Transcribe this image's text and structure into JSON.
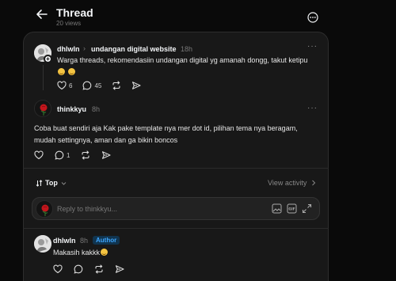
{
  "header": {
    "title": "Thread",
    "views": "20 views"
  },
  "original_post": {
    "username": "dhlwln",
    "topic": "undangan digital website",
    "time": "18h",
    "text": "Warga threads, rekomendasiin undangan digital yg amanah dongg, takut ketipu",
    "likes": "6",
    "replies": "45"
  },
  "reply_post": {
    "username": "thinkkyu",
    "time": "8h",
    "text_line1": "Coba buat sendiri aja Kak pake template nya mer dot id, pilihan tema nya beragam,",
    "text_line2": "mudah settingnya, aman dan ga bikin boncos",
    "replies": "1"
  },
  "sort": {
    "label": "Top",
    "view_activity": "View activity"
  },
  "reply_input": {
    "placeholder": "Reply to thinkkyu..."
  },
  "author_reply": {
    "username": "dhlwln",
    "time": "8h",
    "badge": "Author",
    "text": "Makasih kakkk"
  },
  "colors": {
    "background": "#0a0a0a",
    "card": "#181818",
    "author_badge_bg": "#10344f",
    "author_badge_text": "#3ea6ff"
  },
  "icons": [
    "back-arrow-icon",
    "more-circle-icon",
    "heart-icon",
    "comment-icon",
    "repost-icon",
    "share-icon",
    "gif-icon",
    "image-icon",
    "expand-icon",
    "rose-avatar"
  ]
}
